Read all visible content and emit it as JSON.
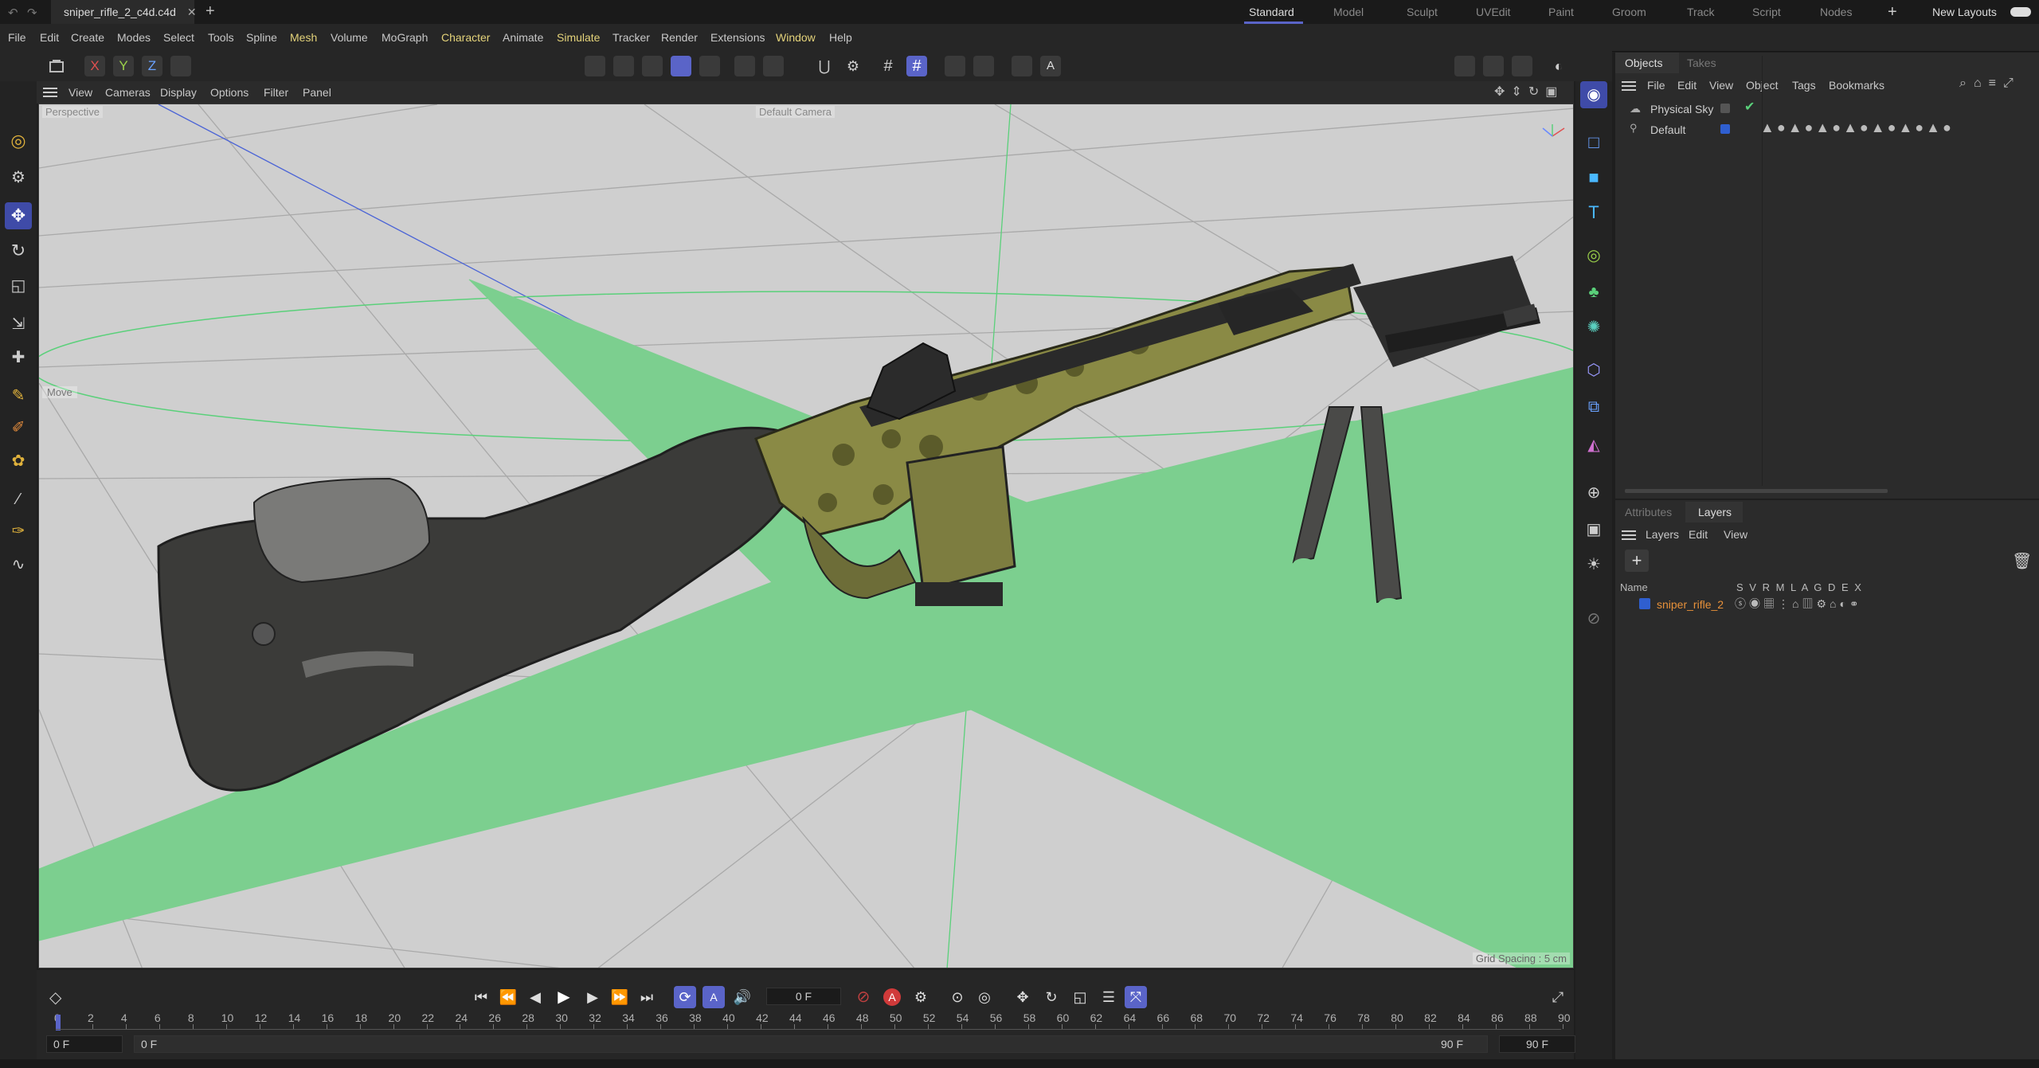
{
  "title_tab": "sniper_rifle_2_c4d.c4d",
  "layouts": {
    "items": [
      "Standard",
      "Model",
      "Sculpt",
      "UVEdit",
      "Paint",
      "Groom",
      "Track",
      "Script",
      "Nodes"
    ],
    "active": "Standard",
    "new_layouts_label": "New Layouts"
  },
  "menu": [
    "File",
    "Edit",
    "Create",
    "Modes",
    "Select",
    "Tools",
    "Spline",
    "Mesh",
    "Volume",
    "MoGraph",
    "Character",
    "Animate",
    "Simulate",
    "Tracker",
    "Render",
    "Extensions",
    "Window",
    "Help"
  ],
  "axis_toggles": [
    "X",
    "Y",
    "Z"
  ],
  "viewport_menu": [
    "View",
    "Cameras",
    "Display",
    "Options",
    "Filter",
    "Panel"
  ],
  "viewport": {
    "projection_label": "Perspective",
    "camera_label": "Default Camera",
    "move_label": "Move",
    "grid_spacing": "Grid Spacing : 5 cm"
  },
  "objects_panel": {
    "tabs": [
      "Objects",
      "Takes"
    ],
    "active_tab": "Objects",
    "menu": [
      "File",
      "Edit",
      "View",
      "Object",
      "Tags",
      "Bookmarks"
    ],
    "rows": [
      {
        "name": "Physical Sky"
      },
      {
        "name": "Default"
      }
    ]
  },
  "layers_panel": {
    "tabs": [
      "Attributes",
      "Layers"
    ],
    "active_tab": "Layers",
    "menu": [
      "Layers",
      "Edit",
      "View"
    ],
    "header_name": "Name",
    "header_flags": "S V R M L A G D E X",
    "rows": [
      {
        "name": "sniper_rifle_2",
        "color": "#2f5fd0"
      }
    ]
  },
  "timeline": {
    "current_frame": "0 F",
    "start_field": "0 F",
    "start_field2": "0 F",
    "end_field": "90 F",
    "end_field2": "90 F",
    "ticks": [
      "0",
      "2",
      "4",
      "6",
      "8",
      "10",
      "12",
      "14",
      "16",
      "18",
      "20",
      "22",
      "24",
      "26",
      "28",
      "30",
      "32",
      "34",
      "36",
      "38",
      "40",
      "42",
      "44",
      "46",
      "48",
      "50",
      "52",
      "54",
      "56",
      "58",
      "60",
      "62",
      "64",
      "66",
      "68",
      "70",
      "72",
      "74",
      "76",
      "78",
      "80",
      "82",
      "84",
      "86",
      "88",
      "90"
    ]
  },
  "colors": {
    "accent": "#5a64c8",
    "menu_highlight": "#e4d37a",
    "layer_name": "#e8913a",
    "ground_plane": "#7ccf8f"
  }
}
